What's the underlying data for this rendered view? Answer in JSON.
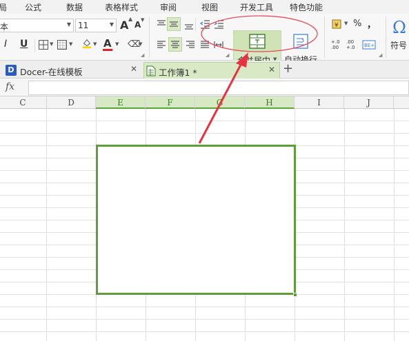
{
  "menu": {
    "items": [
      "局",
      "公式",
      "数据",
      "表格样式",
      "审阅",
      "视图",
      "开发工具",
      "特色功能"
    ]
  },
  "ribbon": {
    "font_name": "本",
    "font_size": "11",
    "increase_font": "A",
    "decrease_font": "A",
    "bold": "I",
    "underline": "U",
    "font_color_glyph": "A",
    "merge_label": "合并居中",
    "wrap_label": "自动换行",
    "percent": "%",
    "comma": "，",
    "symbol_glyph": "Ω",
    "symbol_label": "符号",
    "dec_increase": "+.0\n.00",
    "dec_decrease": ".00\n+.0"
  },
  "tabs": [
    {
      "label": "Docer-在线模板",
      "close": "✕"
    },
    {
      "label": "工作簿1 *",
      "close": "✕"
    }
  ],
  "new_tab": "+",
  "formula_bar": {
    "fx": "fx",
    "value": ""
  },
  "columns": [
    {
      "label": "C",
      "selected": false
    },
    {
      "label": "D",
      "selected": false
    },
    {
      "label": "E",
      "selected": true
    },
    {
      "label": "F",
      "selected": true
    },
    {
      "label": "G",
      "selected": true
    },
    {
      "label": "H",
      "selected": true
    },
    {
      "label": "I",
      "selected": false
    },
    {
      "label": "J",
      "selected": false
    }
  ],
  "colors": {
    "selection": "#5e9e3a",
    "highlight_circle": "#e84b5a",
    "annotation_arrow": "#e8323f",
    "merge_button_bg": "#d9e9c6"
  }
}
